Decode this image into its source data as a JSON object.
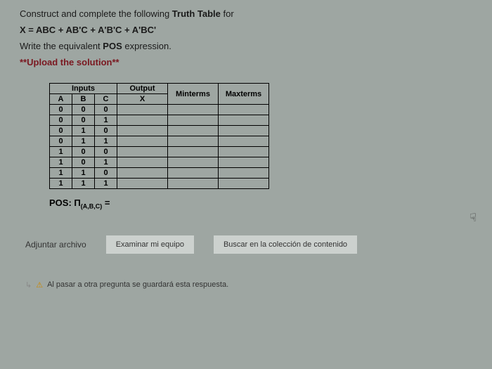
{
  "instructions": {
    "line1_pre": "Construct and complete the following ",
    "line1_bold": "Truth Table",
    "line1_post": " for",
    "formula": "X = ABC + AB'C + A'B'C + A'BC'",
    "line3_pre": "Write the equivalent ",
    "line3_bold": "POS",
    "line3_post": " expression.",
    "stars": "**",
    "upload": "Upload the solution",
    "stars2": "**"
  },
  "table": {
    "inputs_header": "Inputs",
    "output_header": "Output",
    "minterms_header": "Minterms",
    "maxterms_header": "Maxterms",
    "col_a": "A",
    "col_b": "B",
    "col_c": "C",
    "col_x": "X",
    "rows": [
      {
        "a": "0",
        "b": "0",
        "c": "0"
      },
      {
        "a": "0",
        "b": "0",
        "c": "1"
      },
      {
        "a": "0",
        "b": "1",
        "c": "0"
      },
      {
        "a": "0",
        "b": "1",
        "c": "1"
      },
      {
        "a": "1",
        "b": "0",
        "c": "0"
      },
      {
        "a": "1",
        "b": "0",
        "c": "1"
      },
      {
        "a": "1",
        "b": "1",
        "c": "0"
      },
      {
        "a": "1",
        "b": "1",
        "c": "1"
      }
    ]
  },
  "pos": {
    "label_pre": "POS: ",
    "symbol": "Π",
    "sub": "(A,B,C)",
    "eq": " ="
  },
  "attach": {
    "label": "Adjuntar archivo",
    "btn1": "Examinar mi equipo",
    "btn2": "Buscar en la colección de contenido"
  },
  "note": "Al pasar a otra pregunta se guardará esta respuesta."
}
